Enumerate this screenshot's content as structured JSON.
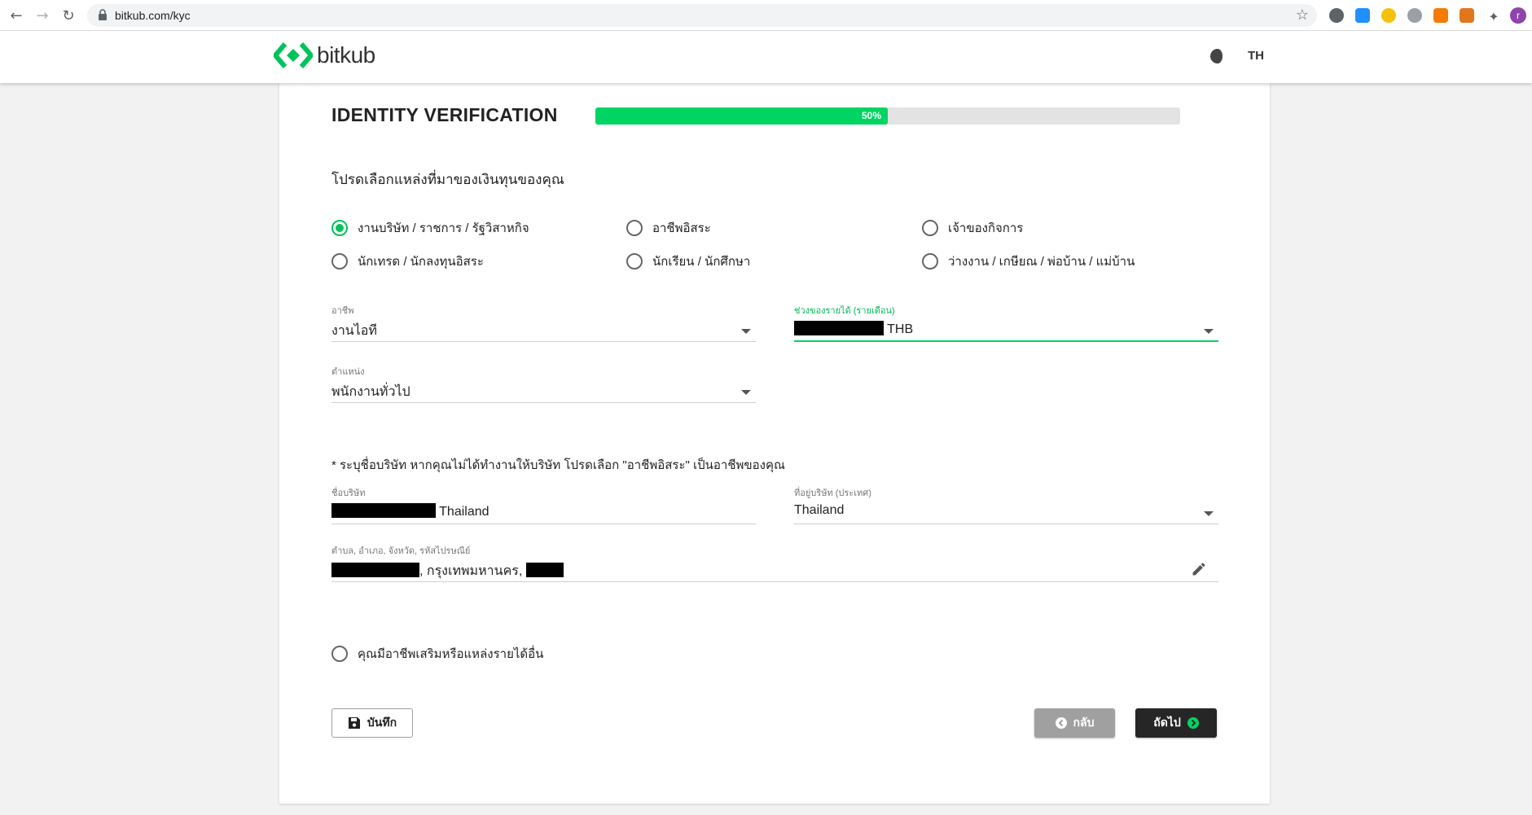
{
  "browser": {
    "url": "bitkub.com/kyc",
    "profile_initial": "r"
  },
  "header": {
    "logo_text": "bitkub",
    "language": "TH"
  },
  "page": {
    "title": "IDENTITY VERIFICATION",
    "progress_label": "50%",
    "progress_value": 0.5,
    "source_heading": "โปรดเลือกแหล่งที่มาของเงินทุนของคุณ",
    "income_options": [
      {
        "label": "งานบริษัท / ราชการ / รัฐวิสาหกิจ",
        "checked": true
      },
      {
        "label": "อาชีพอิสระ",
        "checked": false
      },
      {
        "label": "เจ้าของกิจการ",
        "checked": false
      },
      {
        "label": "นักเทรด / นักลงทุนอิสระ",
        "checked": false
      },
      {
        "label": "นักเรียน / นักศึกษา",
        "checked": false
      },
      {
        "label": "ว่างงาน / เกษียณ / พ่อบ้าน / แม่บ้าน",
        "checked": false
      }
    ],
    "occupation": {
      "label": "อาชีพ",
      "value": "งานไอที"
    },
    "income_range": {
      "label": "ช่วงของรายได้ (รายเดือน)",
      "value_suffix": "THB"
    },
    "position": {
      "label": "ตำแหน่ง",
      "value": "พนักงานทั่วไป"
    },
    "company_note": "* ระบุชื่อบริษัท หากคุณไม่ได้ทำงานให้บริษัท โปรดเลือก \"อาชีพอิสระ\" เป็นอาชีพของคุณ",
    "company_name": {
      "label": "ชื่อบริษัท",
      "value_suffix": "Thailand"
    },
    "company_country": {
      "label": "ที่อยู่บริษัท (ประเทศ)",
      "value": "Thailand"
    },
    "address": {
      "label": "ตำบล, อำเภอ, จังหวัด, รหัสไปรษณีย์",
      "value_middle": ", กรุงเทพมหานคร,"
    },
    "additional_income": {
      "label": "คุณมีอาชีพเสริมหรือแหล่งรายได้อื่น",
      "checked": false
    },
    "buttons": {
      "save": "บันทึก",
      "back": "กลับ",
      "next": "ถัดไป"
    }
  },
  "colors": {
    "accent": "#00d463",
    "radio_checked": "#00c35a",
    "button_dark": "#262626",
    "button_disabled": "#a0a0a0"
  }
}
